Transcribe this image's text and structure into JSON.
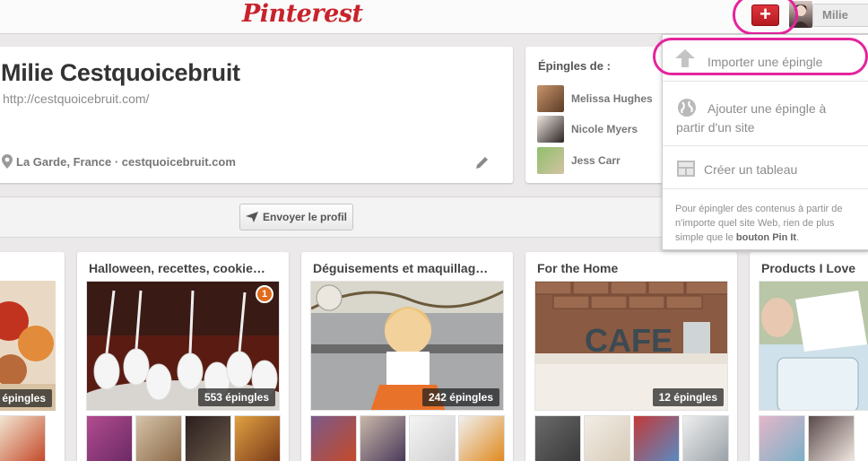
{
  "topbar": {
    "logo": "Pinterest",
    "add_button": "+",
    "user_name": "Milie"
  },
  "profile": {
    "name": "Milie Cestquoicebruit",
    "url": "http://cestquoicebruit.com/",
    "location": "La Garde, France · cestquoicebruit.com"
  },
  "pinners": {
    "title": "Épingles de :",
    "items": [
      {
        "name": "Melissa Hughes"
      },
      {
        "name": "Nicole Myers"
      },
      {
        "name": "Jess Carr"
      }
    ]
  },
  "profile_bar": {
    "send_profile": "Envoyer le profil"
  },
  "boards": [
    {
      "title": "",
      "count": "épingles"
    },
    {
      "title": "Halloween, recettes, cookie…",
      "count": "553 épingles",
      "notification": "1"
    },
    {
      "title": "Déguisements et maquillag…",
      "count": "242 épingles"
    },
    {
      "title": "For the Home",
      "count": "12 épingles"
    },
    {
      "title": "Products I Love",
      "count": ""
    }
  ],
  "dropdown": {
    "import_pin": "Importer une épingle",
    "add_from_site_line1": "Ajouter une épingle à",
    "add_from_site_line2": "partir d'un site",
    "create_board": "Créer un tableau",
    "footer_text": "Pour épingler des contenus à partir de n'importe quel site Web, rien de plus simple que le ",
    "footer_link": "bouton Pin It",
    "footer_end": "."
  },
  "colors": {
    "brand_red": "#c8232c",
    "annotation_pink": "#e4249c"
  }
}
